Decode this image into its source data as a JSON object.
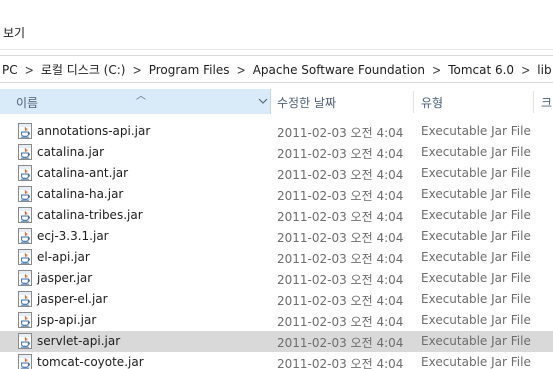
{
  "menu": {
    "view_label": "보기"
  },
  "breadcrumb": {
    "items": [
      "PC",
      "로컬 디스크 (C:)",
      "Program Files",
      "Apache Software Foundation",
      "Tomcat 6.0",
      "lib"
    ]
  },
  "columns": {
    "name": "이름",
    "date": "수정한 날짜",
    "type": "유형",
    "size": "크"
  },
  "files": [
    {
      "name": "annotations-api.jar",
      "date": "2011-02-03 오전 4:04",
      "type": "Executable Jar File"
    },
    {
      "name": "catalina.jar",
      "date": "2011-02-03 오전 4:04",
      "type": "Executable Jar File"
    },
    {
      "name": "catalina-ant.jar",
      "date": "2011-02-03 오전 4:04",
      "type": "Executable Jar File"
    },
    {
      "name": "catalina-ha.jar",
      "date": "2011-02-03 오전 4:04",
      "type": "Executable Jar File"
    },
    {
      "name": "catalina-tribes.jar",
      "date": "2011-02-03 오전 4:04",
      "type": "Executable Jar File"
    },
    {
      "name": "ecj-3.3.1.jar",
      "date": "2011-02-03 오전 4:04",
      "type": "Executable Jar File"
    },
    {
      "name": "el-api.jar",
      "date": "2011-02-03 오전 4:04",
      "type": "Executable Jar File"
    },
    {
      "name": "jasper.jar",
      "date": "2011-02-03 오전 4:04",
      "type": "Executable Jar File"
    },
    {
      "name": "jasper-el.jar",
      "date": "2011-02-03 오전 4:04",
      "type": "Executable Jar File"
    },
    {
      "name": "jsp-api.jar",
      "date": "2011-02-03 오전 4:04",
      "type": "Executable Jar File"
    },
    {
      "name": "servlet-api.jar",
      "date": "2011-02-03 오전 4:04",
      "type": "Executable Jar File",
      "selected": true
    },
    {
      "name": "tomcat-coyote.jar",
      "date": "2011-02-03 오전 4:04",
      "type": "Executable Jar File"
    }
  ],
  "icon": "java-jar-file-icon",
  "colors": {
    "selected_row": "#d9d9d9",
    "sorted_column": "#d9ebf9",
    "header_text": "#4c607a"
  }
}
